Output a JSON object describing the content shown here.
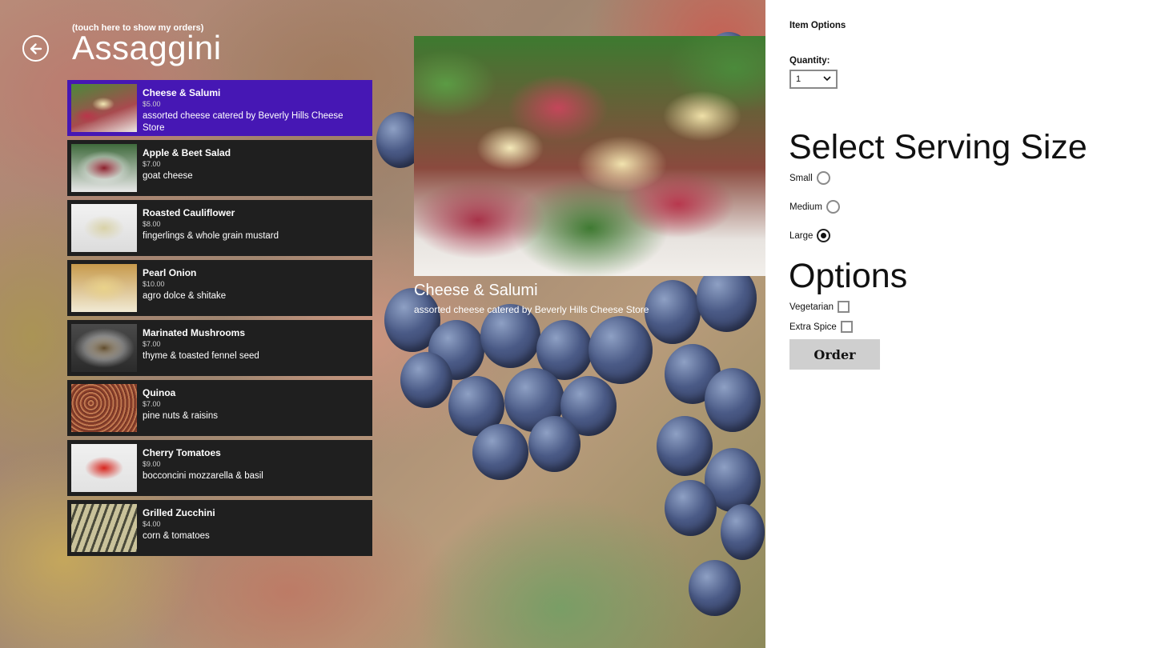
{
  "header": {
    "orders_link": "(touch here to show my orders)",
    "title": "Assaggini"
  },
  "menu": {
    "selected_color": "#4617b4",
    "items": [
      {
        "name": "Cheese & Salumi",
        "price": "$5.00",
        "desc": "assorted cheese catered by Beverly Hills Cheese Store"
      },
      {
        "name": "Apple & Beet Salad",
        "price": "$7.00",
        "desc": "goat cheese"
      },
      {
        "name": "Roasted Cauliflower",
        "price": "$8.00",
        "desc": "fingerlings & whole grain mustard"
      },
      {
        "name": "Pearl Onion",
        "price": "$10.00",
        "desc": "agro dolce & shitake"
      },
      {
        "name": "Marinated Mushrooms",
        "price": "$7.00",
        "desc": "thyme & toasted fennel seed"
      },
      {
        "name": "Quinoa",
        "price": "$7.00",
        "desc": "pine nuts & raisins"
      },
      {
        "name": "Cherry Tomatoes",
        "price": "$9.00",
        "desc": "bocconcini mozzarella & basil"
      },
      {
        "name": "Grilled Zucchini",
        "price": "$4.00",
        "desc": "corn & tomatoes"
      }
    ]
  },
  "detail": {
    "name": "Cheese & Salumi",
    "desc": "assorted cheese catered by Beverly Hills Cheese Store"
  },
  "panel": {
    "title": "Item Options",
    "quantity_label": "Quantity:",
    "quantity_value": "1",
    "serving_title": "Select Serving Size",
    "sizes": [
      {
        "label": "Small",
        "checked": false
      },
      {
        "label": "Medium",
        "checked": false
      },
      {
        "label": "Large",
        "checked": true
      }
    ],
    "options_title": "Options",
    "options": [
      {
        "label": "Vegetarian",
        "checked": false
      },
      {
        "label": "Extra Spice",
        "checked": false
      }
    ],
    "order_label": "Order"
  }
}
